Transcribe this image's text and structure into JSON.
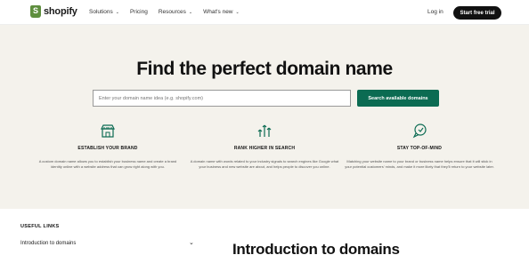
{
  "header": {
    "logo_text": "shopify",
    "nav": [
      {
        "label": "Solutions",
        "has_menu": true
      },
      {
        "label": "Pricing",
        "has_menu": false
      },
      {
        "label": "Resources",
        "has_menu": true
      },
      {
        "label": "What's new",
        "has_menu": true
      }
    ],
    "login_label": "Log in",
    "cta_label": "Start free trial"
  },
  "hero": {
    "title": "Find the perfect domain name",
    "search_placeholder": "Enter your domain name idea (e.g. shopify.com)",
    "search_button": "Search available domains",
    "features": [
      {
        "icon": "storefront-icon",
        "title": "ESTABLISH YOUR BRAND",
        "text": "A custom domain name allows you to establish your business name and create a brand identity online with a website address that can grow right along with you."
      },
      {
        "icon": "growth-arrows-icon",
        "title": "RANK HIGHER IN SEARCH",
        "text": "A domain name with words related to your industry signals to search engines like Google what your business and new website are about, and helps people to discover you online."
      },
      {
        "icon": "chat-bubble-icon",
        "title": "STAY TOP-OF-MIND",
        "text": "Matching your website name to your brand or business name helps ensure that it will stick in your potential customers' minds, and make it more likely that they'll return to your website later."
      }
    ]
  },
  "lower": {
    "useful_links_heading": "USEFUL LINKS",
    "intro_link": "Introduction to domains",
    "intro_title": "Introduction to domains"
  },
  "colors": {
    "brand_green": "#5e8e3e",
    "button_green": "#0b6b52",
    "hero_bg": "#f4f2ec",
    "cta_bg": "#111111"
  }
}
